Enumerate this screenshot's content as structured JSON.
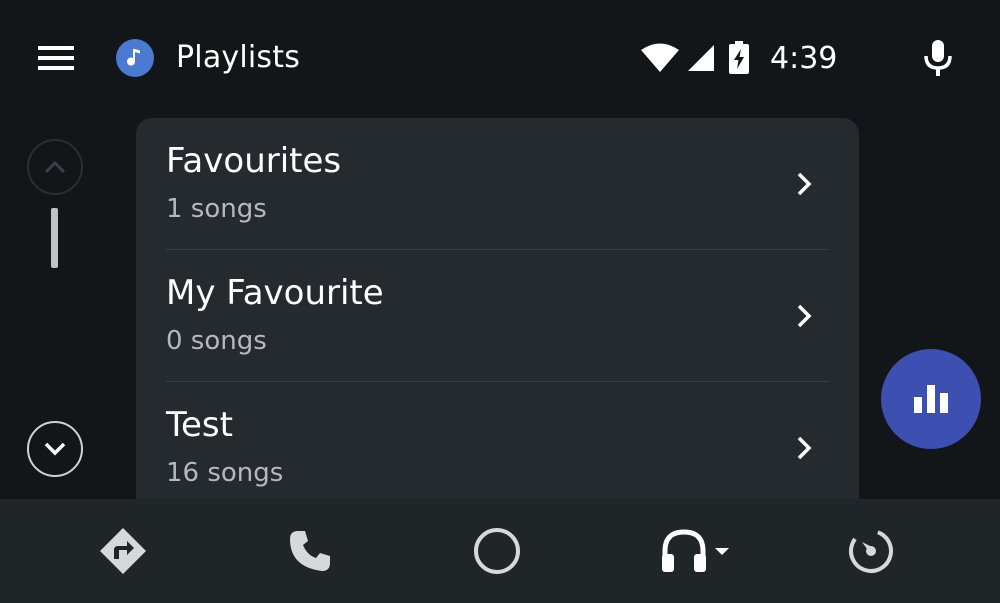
{
  "header": {
    "title": "Playlists",
    "app_icon": "music-note-icon",
    "clock": "4:39",
    "status_icons": [
      "wifi-icon",
      "cell-signal-icon",
      "battery-charging-icon"
    ]
  },
  "playlists": [
    {
      "title": "Favourites",
      "subtitle": "1 songs"
    },
    {
      "title": "My Favourite",
      "subtitle": "0 songs"
    },
    {
      "title": "Test",
      "subtitle": "16 songs"
    }
  ],
  "bottom_nav": {
    "items": [
      "navigation-icon",
      "phone-icon",
      "home-icon",
      "headphones-icon",
      "exit-gauge-icon"
    ]
  },
  "colors": {
    "background": "#121619",
    "card": "#252a2e",
    "accent_fab": "#3d4fb0",
    "app_icon": "#4a7bd0"
  }
}
